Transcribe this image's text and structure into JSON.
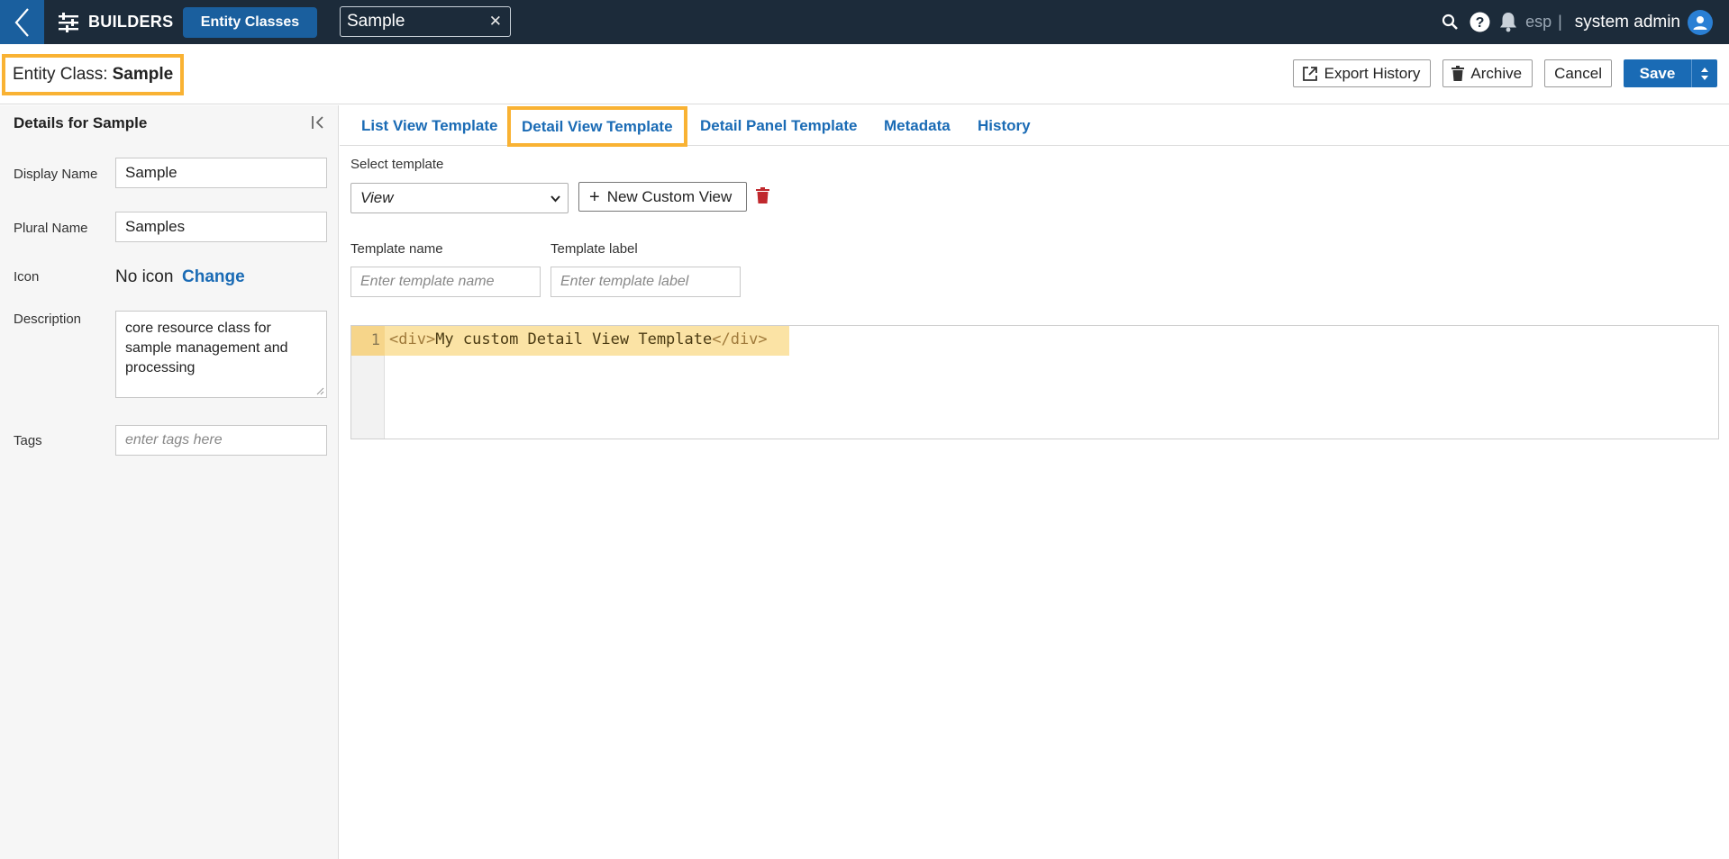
{
  "topbar": {
    "section_title": "BUILDERS",
    "nav_button": "Entity Classes",
    "open_tab": "Sample",
    "locale": "esp",
    "separator": "|",
    "user_name": "system admin",
    "colors": {
      "bar": "#1c2b3a",
      "accent": "#1a5f9e"
    }
  },
  "header": {
    "title_prefix": "Entity Class:",
    "title_name": "Sample",
    "export_history": "Export History",
    "archive": "Archive",
    "cancel": "Cancel",
    "save": "Save",
    "highlight_color": "#f9b233"
  },
  "sidebar": {
    "title": "Details for Sample",
    "display_name_label": "Display Name",
    "display_name_value": "Sample",
    "plural_name_label": "Plural Name",
    "plural_name_value": "Samples",
    "icon_label": "Icon",
    "icon_value": "No icon",
    "icon_change": "Change",
    "description_label": "Description",
    "description_value": "core resource class for sample management and processing",
    "tags_label": "Tags",
    "tags_placeholder": "enter tags here"
  },
  "tabs": [
    {
      "label": "List View Template",
      "active": false
    },
    {
      "label": "Detail View Template",
      "active": true
    },
    {
      "label": "Detail Panel Template",
      "active": false
    },
    {
      "label": "Metadata",
      "active": false
    },
    {
      "label": "History",
      "active": false
    }
  ],
  "template": {
    "select_label": "Select template",
    "selected": "View",
    "new_view_button": "New Custom View",
    "name_label": "Template name",
    "name_placeholder": "Enter template name",
    "label_label": "Template label",
    "label_placeholder": "Enter template label"
  },
  "editor": {
    "line_number": "1",
    "open_tag": "<div>",
    "text": "My custom Detail View Template",
    "close_tag": "</div>"
  }
}
